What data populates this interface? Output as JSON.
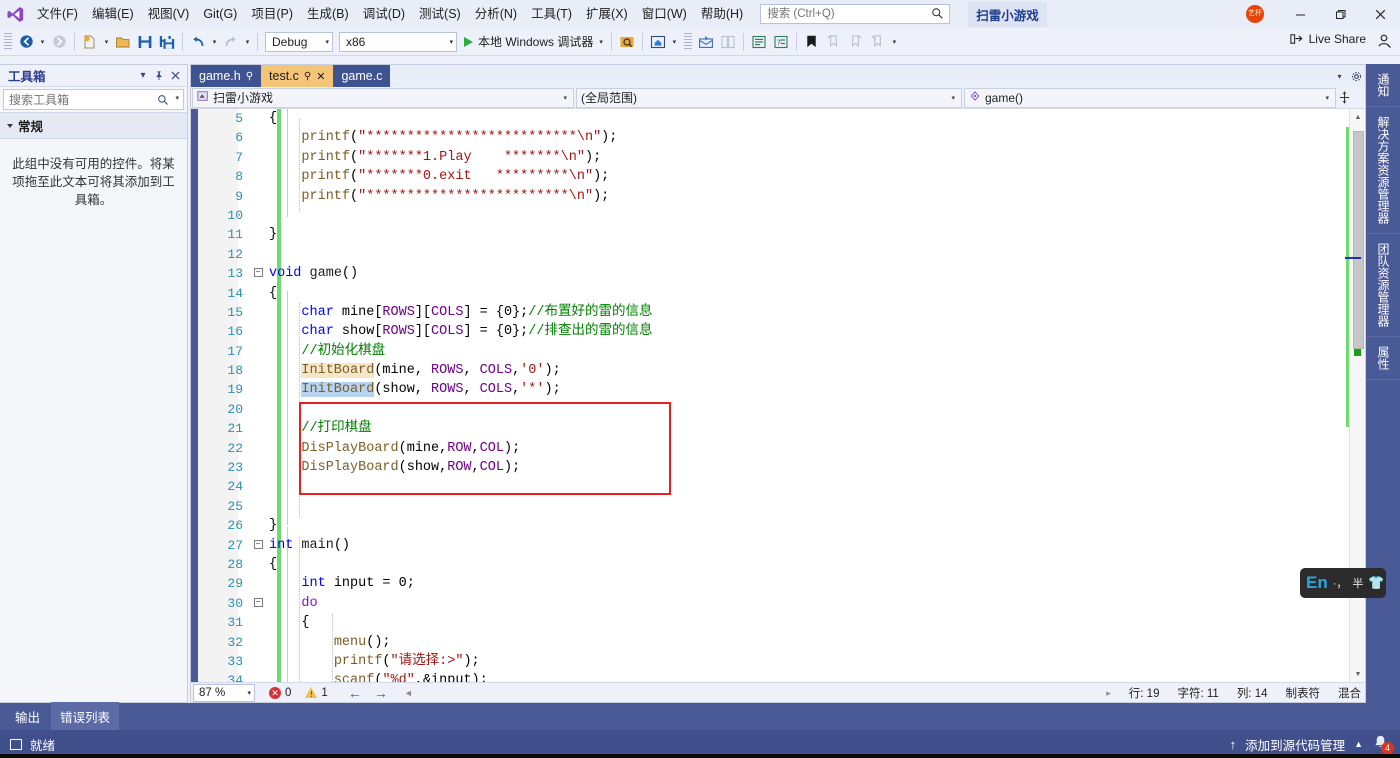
{
  "window": {
    "project_chip": "扫雷小游戏",
    "avatar_initials": "艺杯",
    "minimize": "—",
    "restore": "❐",
    "close": "✕"
  },
  "menubar": {
    "items": [
      {
        "label": "文件(F)"
      },
      {
        "label": "编辑(E)"
      },
      {
        "label": "视图(V)"
      },
      {
        "label": "Git(G)"
      },
      {
        "label": "项目(P)"
      },
      {
        "label": "生成(B)"
      },
      {
        "label": "调试(D)"
      },
      {
        "label": "测试(S)"
      },
      {
        "label": "分析(N)"
      },
      {
        "label": "工具(T)"
      },
      {
        "label": "扩展(X)"
      },
      {
        "label": "窗口(W)"
      },
      {
        "label": "帮助(H)"
      }
    ],
    "search_placeholder": "搜索 (Ctrl+Q)"
  },
  "toolbar": {
    "config": "Debug",
    "platform": "x86",
    "run_label": "本地 Windows 调试器",
    "live_share": "Live Share"
  },
  "toolbox": {
    "title": "工具箱",
    "search_placeholder": "搜索工具箱",
    "group": "常规",
    "empty_text": "此组中没有可用的控件。将某项拖至此文本可将其添加到工具箱。"
  },
  "tabs": [
    {
      "label": "game.h",
      "pinned": true,
      "active": false
    },
    {
      "label": "test.c",
      "pinned": true,
      "active": true
    },
    {
      "label": "game.c",
      "pinned": false,
      "active": false
    }
  ],
  "navbar": {
    "project": "扫雷小游戏",
    "scope": "(全局范围)",
    "member": "game()"
  },
  "editor": {
    "first_visible_line": 5,
    "lines": [
      {
        "n": 5,
        "fold": "",
        "html": "{"
      },
      {
        "n": 6,
        "fold": "",
        "html": "    <span class='fn'>printf</span>(<span class='str'>\"**************************\\n\"</span>);"
      },
      {
        "n": 7,
        "fold": "",
        "html": "    <span class='fn'>printf</span>(<span class='str'>\"*******1.Play    *******\\n\"</span>);"
      },
      {
        "n": 8,
        "fold": "",
        "html": "    <span class='fn'>printf</span>(<span class='str'>\"*******0.exit   *********\\n\"</span>);"
      },
      {
        "n": 9,
        "fold": "",
        "html": "    <span class='fn'>printf</span>(<span class='str'>\"*************************\\n\"</span>);"
      },
      {
        "n": 10,
        "fold": "",
        "html": ""
      },
      {
        "n": 11,
        "fold": "",
        "html": "}"
      },
      {
        "n": 12,
        "fold": "",
        "html": ""
      },
      {
        "n": 13,
        "fold": "-",
        "html": "<span class='k'>void</span> <span class='id'>game</span>()"
      },
      {
        "n": 14,
        "fold": "",
        "html": "{"
      },
      {
        "n": 15,
        "fold": "",
        "html": "    <span class='k'>char</span> mine[<span class='mac'>ROWS</span>][<span class='mac'>COLS</span>] = {0};<span class='cmt'>//布置好的雷的信息</span>"
      },
      {
        "n": 16,
        "fold": "",
        "html": "    <span class='k'>char</span> show[<span class='mac'>ROWS</span>][<span class='mac'>COLS</span>] = {0};<span class='cmt'>//排查出的雷的信息</span>"
      },
      {
        "n": 17,
        "fold": "",
        "html": "    <span class='cmt'>//初始化棋盘</span>"
      },
      {
        "n": 18,
        "fold": "",
        "html": "    <span class='fn hl-a'>InitBoard</span>(mine, <span class='mac'>ROWS</span>, <span class='mac'>COLS</span>,<span class='str'>'0'</span>);"
      },
      {
        "n": 19,
        "fold": "",
        "html": "    <span class='fn hl-b'>InitBoard</span>(show, <span class='mac'>ROWS</span>, <span class='mac'>COLS</span>,<span class='str'>'*'</span>);"
      },
      {
        "n": 20,
        "fold": "",
        "html": ""
      },
      {
        "n": 21,
        "fold": "",
        "html": "    <span class='cmt'>//打印棋盘</span>"
      },
      {
        "n": 22,
        "fold": "",
        "html": "    <span class='fn'>DisPlayBoard</span>(mine,<span class='mac'>ROW</span>,<span class='mac'>COL</span>);"
      },
      {
        "n": 23,
        "fold": "",
        "html": "    <span class='fn'>DisPlayBoard</span>(show,<span class='mac'>ROW</span>,<span class='mac'>COL</span>);"
      },
      {
        "n": 24,
        "fold": "",
        "html": ""
      },
      {
        "n": 25,
        "fold": "",
        "html": ""
      },
      {
        "n": 26,
        "fold": "",
        "html": "}"
      },
      {
        "n": 27,
        "fold": "-",
        "html": "<span class='k'>int</span> <span class='id'>main</span>()"
      },
      {
        "n": 28,
        "fold": "",
        "html": "{"
      },
      {
        "n": 29,
        "fold": "",
        "html": "    <span class='k'>int</span> input = 0;"
      },
      {
        "n": 30,
        "fold": "-",
        "html": "    <span class='kp'>do</span>"
      },
      {
        "n": 31,
        "fold": "",
        "html": "    {"
      },
      {
        "n": 32,
        "fold": "",
        "html": "        <span class='fn'>menu</span>();"
      },
      {
        "n": 33,
        "fold": "",
        "html": "        <span class='fn'>printf</span>(<span class='str'>\"请选择:&gt;\"</span>);"
      },
      {
        "n": 34,
        "fold": "",
        "html": "        <span class='fn squig'>scanf</span>(<span class='str'>\"%d\"</span>,&amp;input);"
      }
    ],
    "annotation_rect": {
      "from_line": 20,
      "to_line": 24
    }
  },
  "editor_status": {
    "zoom": "87 %",
    "errors": "0",
    "warnings": "1",
    "back_arrow": "←",
    "forward_arrow": "→",
    "row": "行: 19",
    "char": "字符: 11",
    "col": "列: 14",
    "tabs_mode": "制表符",
    "mixed": "混合"
  },
  "rail": {
    "tabs": [
      "通知",
      "解决方案资源管理器",
      "团队资源管理器",
      "属性"
    ]
  },
  "bottom_tabs": [
    {
      "label": "输出",
      "active": false
    },
    {
      "label": "错误列表",
      "active": true
    }
  ],
  "statusbar": {
    "ready": "就绪",
    "source_control": "添加到源代码管理",
    "notification_count": "4"
  },
  "ime": {
    "lang": "En",
    "punct": "·，",
    "width_mode": "半",
    "skin": "👕"
  },
  "colors": {
    "accent_blue": "#4a5a96",
    "title_bg": "#e9edf7",
    "active_tab": "#f5c577",
    "annotation_red": "#e8201f",
    "change_green": "#6fdb6f",
    "keyword_blue": "#0000ff",
    "string_red": "#a31515",
    "comment_green": "#008000",
    "macro_purple": "#6f008a",
    "func_gold": "#795e26"
  }
}
